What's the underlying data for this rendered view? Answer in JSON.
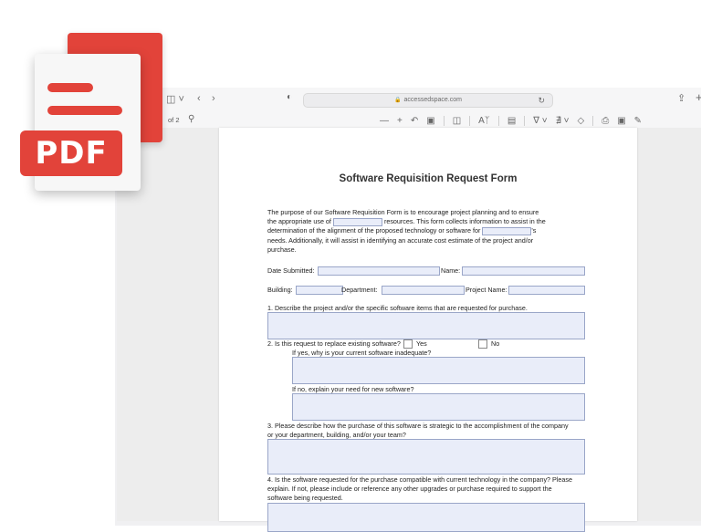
{
  "browser": {
    "url": "accessedspace.com",
    "page_indicator": "of 2"
  },
  "icons": {
    "sidebar": "sidebar-icon",
    "back": "back-icon",
    "forward": "forward-icon",
    "search": "search-icon",
    "shield": "shield-icon",
    "lock": "lock-icon",
    "reload": "reload-icon",
    "share": "share-icon",
    "new_tab": "plus-icon"
  },
  "pdf_logo": {
    "label": "PDF",
    "accent": "#e2433a"
  },
  "form": {
    "title": "Software Requisition Request Form",
    "intro_1": "The purpose of our Software Requisition Form is to encourage project planning and to ensure",
    "intro_2a": "the appropriate use of",
    "intro_2b": "resources. This form collects information to assist in the",
    "intro_3a": "determination of the alignment of the proposed technology or software for",
    "intro_3b": "'s",
    "intro_4": "needs. Additionally, it will assist in identifying an accurate cost estimate of the project and/or",
    "intro_5": "purchase.",
    "date_label": "Date Submitted:",
    "name_label": "Name:",
    "building_label": "Building:",
    "department_label": "Department:",
    "project_label": "Project Name:",
    "q1": "1. Describe the project and/or the specific software items that are requested for purchase.",
    "q2": "2. Is this request to replace existing software?",
    "q2_yes": "Yes",
    "q2_no": "No",
    "q2_yes_follow": "If yes, why is your current software inadequate?",
    "q2_no_follow": "If no, explain your need for new software?",
    "q3_1": "3. Please describe how the purchase of this software is strategic to the accomplishment of the company",
    "q3_2": "or your department, building, and/or your team?",
    "q4_1": "4. Is the software requested for the purchase compatible with current technology in the company? Please",
    "q4_2": "explain. If not, please include or reference any other upgrades or purchase required to support the",
    "q4_3": "software being requested."
  }
}
